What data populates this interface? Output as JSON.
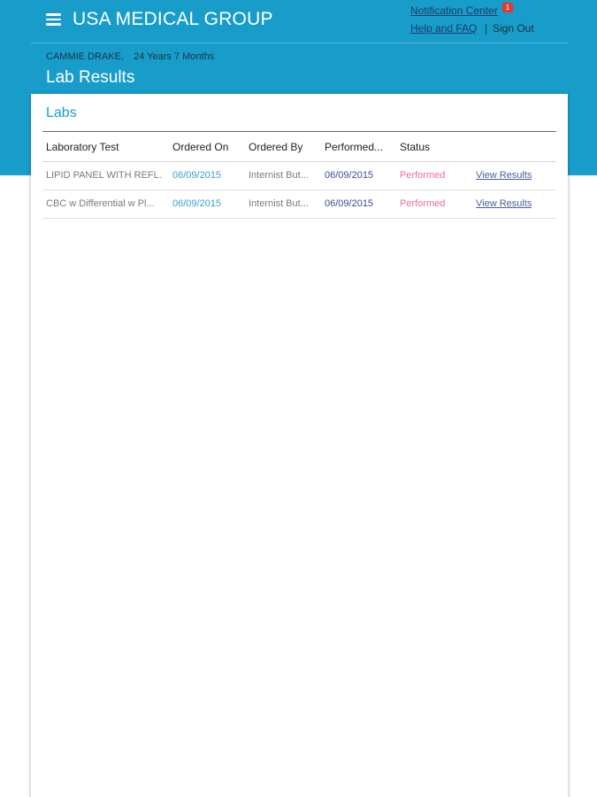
{
  "header": {
    "app_title": "USA MEDICAL GROUP",
    "notification_center": "Notification Center",
    "notification_count": "1",
    "help_faq": "Help and FAQ",
    "separator": "|",
    "sign_out": "Sign Out"
  },
  "patient": {
    "name": "CAMMIE DRAKE,",
    "age": "24 Years 7 Months"
  },
  "page": {
    "title": "Lab Results"
  },
  "labs": {
    "card_title": "Labs",
    "columns": {
      "test": "Laboratory Test",
      "ordered_on": "Ordered On",
      "ordered_by": "Ordered By",
      "performed": "Performed...",
      "status": "Status"
    },
    "rows": [
      {
        "test": "LIPID PANEL WITH REFL...",
        "ordered_on": "06/09/2015",
        "ordered_by": "Internist But...",
        "performed": "06/09/2015",
        "status": "Performed",
        "action": "View Results"
      },
      {
        "test": "CBC w Differential w Pl...",
        "ordered_on": "06/09/2015",
        "ordered_by": "Internist But...",
        "performed": "06/09/2015",
        "status": "Performed",
        "action": "View Results"
      }
    ]
  },
  "colors": {
    "brand_blue": "#189dcb",
    "status_performed": "#ef6aa0",
    "notification_badge": "#e33a2e"
  },
  "icons": {
    "menu": "hamburger-menu-icon"
  }
}
